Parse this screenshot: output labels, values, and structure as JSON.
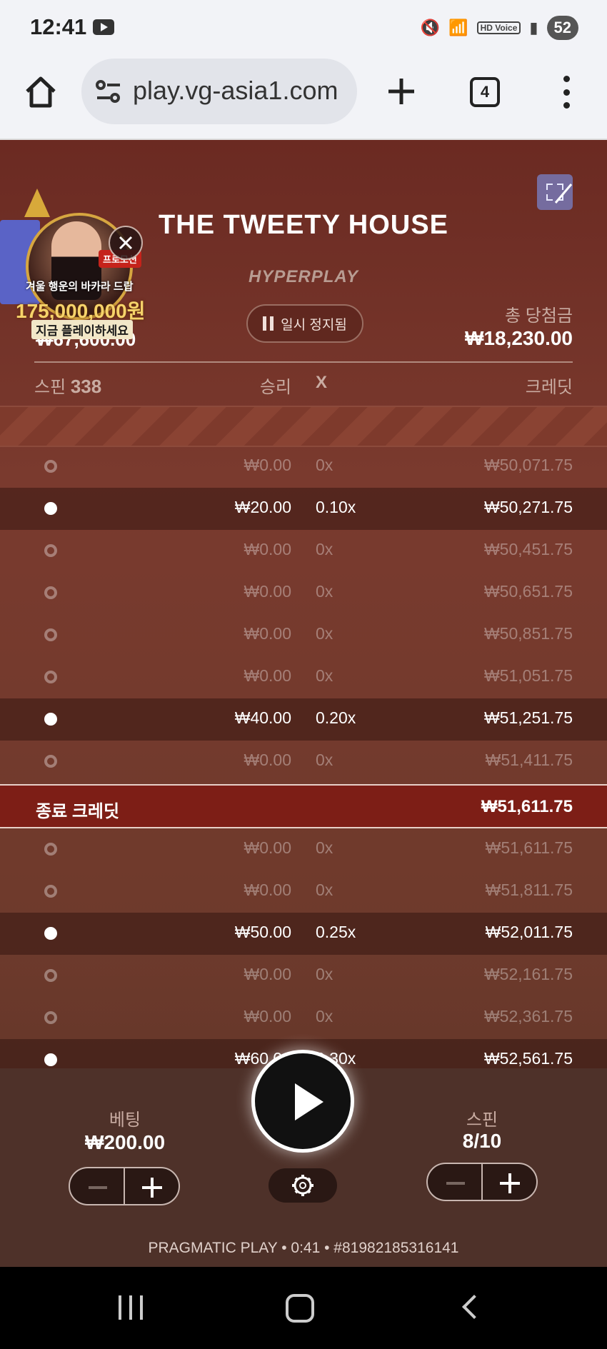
{
  "statusbar": {
    "time": "12:41",
    "battery": "52",
    "hd_label": "HD Voice"
  },
  "browser": {
    "url": "play.vg-asia1.com",
    "tab_count": "4"
  },
  "game": {
    "title": "THE TWEETY HOUSE",
    "brand": "HYPERPLAY",
    "pause_label": "일시 정지됨",
    "left_amount": "₩67,600.00",
    "total_win_label": "총 당첨금",
    "total_win_value": "₩18,230.00",
    "header": {
      "spin_label": "스핀",
      "spin_count": "338",
      "win_label": "승리",
      "x_label": "X",
      "credit_label": "크레딧"
    },
    "rows": [
      {
        "win": "₩0.00",
        "x": "0x",
        "credit": "₩50,071.75"
      },
      {
        "win": "₩20.00",
        "x": "0.10x",
        "credit": "₩50,271.75"
      },
      {
        "win": "₩0.00",
        "x": "0x",
        "credit": "₩50,451.75"
      },
      {
        "win": "₩0.00",
        "x": "0x",
        "credit": "₩50,651.75"
      },
      {
        "win": "₩0.00",
        "x": "0x",
        "credit": "₩50,851.75"
      },
      {
        "win": "₩0.00",
        "x": "0x",
        "credit": "₩51,051.75"
      },
      {
        "win": "₩40.00",
        "x": "0.20x",
        "credit": "₩51,251.75"
      },
      {
        "win": "₩0.00",
        "x": "0x",
        "credit": "₩51,411.75"
      }
    ],
    "end_credit_label": "종료 크레딧",
    "end_credit_value": "₩51,611.75",
    "rows_after": [
      {
        "win": "₩0.00",
        "x": "0x",
        "credit": "₩51,611.75"
      },
      {
        "win": "₩0.00",
        "x": "0x",
        "credit": "₩51,811.75"
      },
      {
        "win": "₩50.00",
        "x": "0.25x",
        "credit": "₩52,011.75"
      },
      {
        "win": "₩0.00",
        "x": "0x",
        "credit": "₩52,161.75"
      },
      {
        "win": "₩0.00",
        "x": "0x",
        "credit": "₩52,361.75"
      },
      {
        "win": "₩60.00",
        "x": "0.30x",
        "credit": "₩52,561.75"
      }
    ]
  },
  "promo": {
    "tag": "프로모션",
    "line1": "겨울 행운의 바카라 드랍",
    "line2": "175,000,000원",
    "line3": "지금 플레이하세요"
  },
  "controls": {
    "bet_label": "베팅",
    "bet_value": "₩200.00",
    "spin_label": "스핀",
    "spin_value": "8/10",
    "footer": "PRAGMATIC PLAY • 0:41 • #81982185316141"
  }
}
